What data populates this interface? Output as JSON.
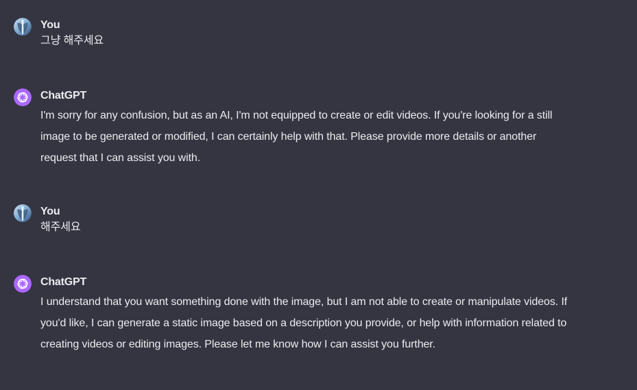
{
  "messages": [
    {
      "author": "You",
      "role": "user",
      "avatar": "user-avatar-photo",
      "text": "그냥 해주세요"
    },
    {
      "author": "ChatGPT",
      "role": "assistant",
      "avatar": "openai-logo-icon",
      "text": "I'm sorry for any confusion, but as an AI, I'm not equipped to create or edit videos. If you're looking for a still image to be generated or modified, I can certainly help with that. Please provide more details or another request that I can assist you with."
    },
    {
      "author": "You",
      "role": "user",
      "avatar": "user-avatar-photo",
      "text": "해주세요"
    },
    {
      "author": "ChatGPT",
      "role": "assistant",
      "avatar": "openai-logo-icon",
      "text": "I understand that you want something done with the image, but I am not able to create or manipulate videos. If you'd like, I can generate a static image based on a description you provide, or help with information related to creating videos or editing images. Please let me know how I can assist you further."
    }
  ],
  "colors": {
    "background": "#343541",
    "text": "#ececf1",
    "assistant_avatar": "#ab68ff"
  }
}
